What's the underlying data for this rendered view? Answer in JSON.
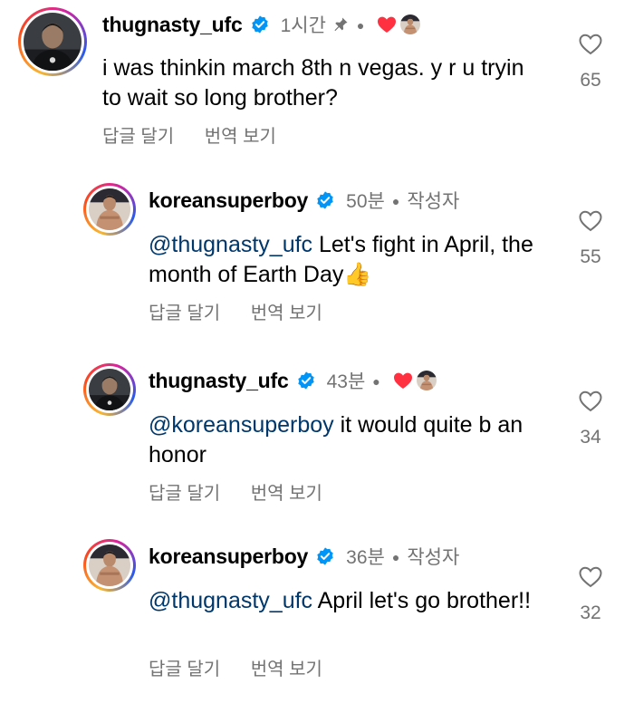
{
  "comments": [
    {
      "username": "thugnasty_ufc",
      "verified": true,
      "time": "1시간",
      "pinned": true,
      "author_label": "",
      "creator_liked": true,
      "text_mention": "",
      "text_body": "i was thinkin march 8th n vegas. y r u tryin to wait so long brother?",
      "reply_label": "답글 달기",
      "translate_label": "번역 보기",
      "like_count": "65"
    },
    {
      "username": "koreansuperboy",
      "verified": true,
      "time": "50분",
      "pinned": false,
      "author_label": "작성자",
      "creator_liked": false,
      "text_mention": "@thugnasty_ufc",
      "text_body": " Let's fight in April, the month of Earth Day👍",
      "reply_label": "답글 달기",
      "translate_label": "번역 보기",
      "like_count": "55"
    },
    {
      "username": "thugnasty_ufc",
      "verified": true,
      "time": "43분",
      "pinned": false,
      "author_label": "",
      "creator_liked": true,
      "text_mention": "@koreansuperboy",
      "text_body": " it would quite b an honor",
      "reply_label": "답글 달기",
      "translate_label": "번역 보기",
      "like_count": "34"
    },
    {
      "username": "koreansuperboy",
      "verified": true,
      "time": "36분",
      "pinned": false,
      "author_label": "작성자",
      "creator_liked": false,
      "text_mention": "@thugnasty_ufc",
      "text_body": " April let's go brother!!",
      "reply_label": "답글 달기",
      "translate_label": "번역 보기",
      "like_count": "32"
    }
  ],
  "colors": {
    "verified_blue": "#0095f6",
    "mention": "#00376b",
    "meta_gray": "#737373",
    "liked_red": "#ff3040"
  },
  "icons": {
    "verified": "verified-badge-icon",
    "pin": "pin-icon",
    "creator_heart": "heart-filled-icon",
    "like": "heart-outline-icon"
  }
}
